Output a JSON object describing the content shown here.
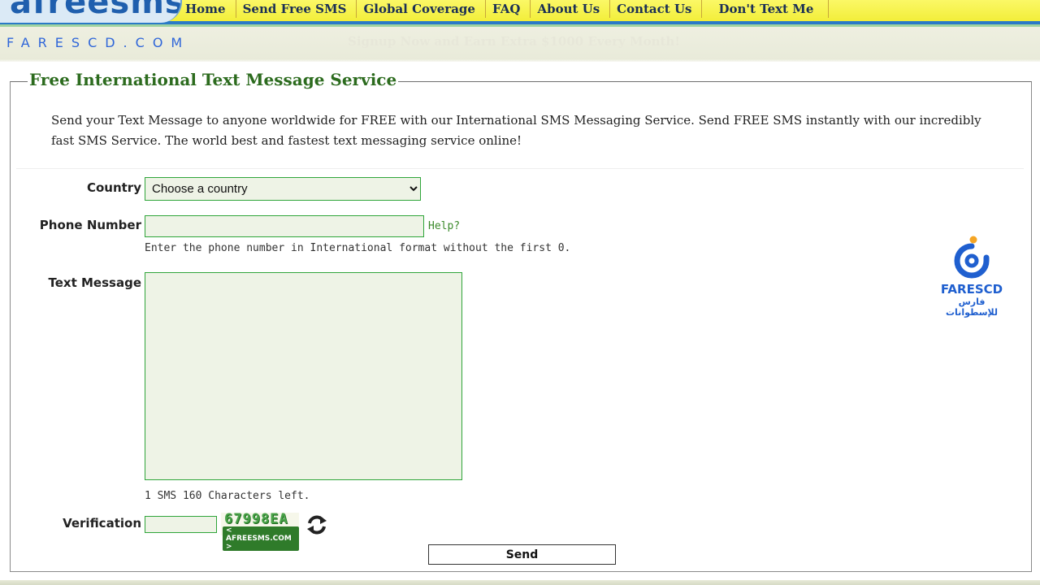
{
  "header": {
    "logo": "afreesms",
    "nav": [
      {
        "label": "Home"
      },
      {
        "label": "Send Free SMS"
      },
      {
        "label": "Global Coverage"
      },
      {
        "label": "FAQ"
      },
      {
        "label": "About Us"
      },
      {
        "label": "Contact Us"
      },
      {
        "label": "Don't Text Me"
      }
    ],
    "site_name": "FARESCD.COM",
    "promo": "Signup Now and Earn Extra $1000 Every Month!"
  },
  "form": {
    "legend": "Free International Text Message Service",
    "intro": "Send your Text Message to anyone worldwide for FREE with our International SMS Messaging Service. Send FREE SMS instantly with our incredibly fast SMS Service. The world best and fastest text messaging service online!",
    "country_label": "Country",
    "country_selected": "Choose a country",
    "phone_label": "Phone Number",
    "phone_value": "",
    "help_link": "Help?",
    "phone_hint": "Enter the phone number in International format without the first 0.",
    "message_label": "Text Message",
    "message_value": "",
    "char_counter": "1 SMS 160 Characters left.",
    "verification_label": "Verification",
    "verification_value": "",
    "captcha_code": "67998EA",
    "captcha_domain": "< AFREESMS.COM >",
    "send_label": "Send"
  },
  "watermark": {
    "name": "FARESCD",
    "arabic": "فارس للإسطوانات"
  },
  "colors": {
    "nav_bar": "#f2ee3a",
    "accent_blue": "#2a7ac7",
    "legend_green": "#2c6b1e",
    "field_border": "#2fa53a",
    "field_bg": "#eef3e6"
  }
}
